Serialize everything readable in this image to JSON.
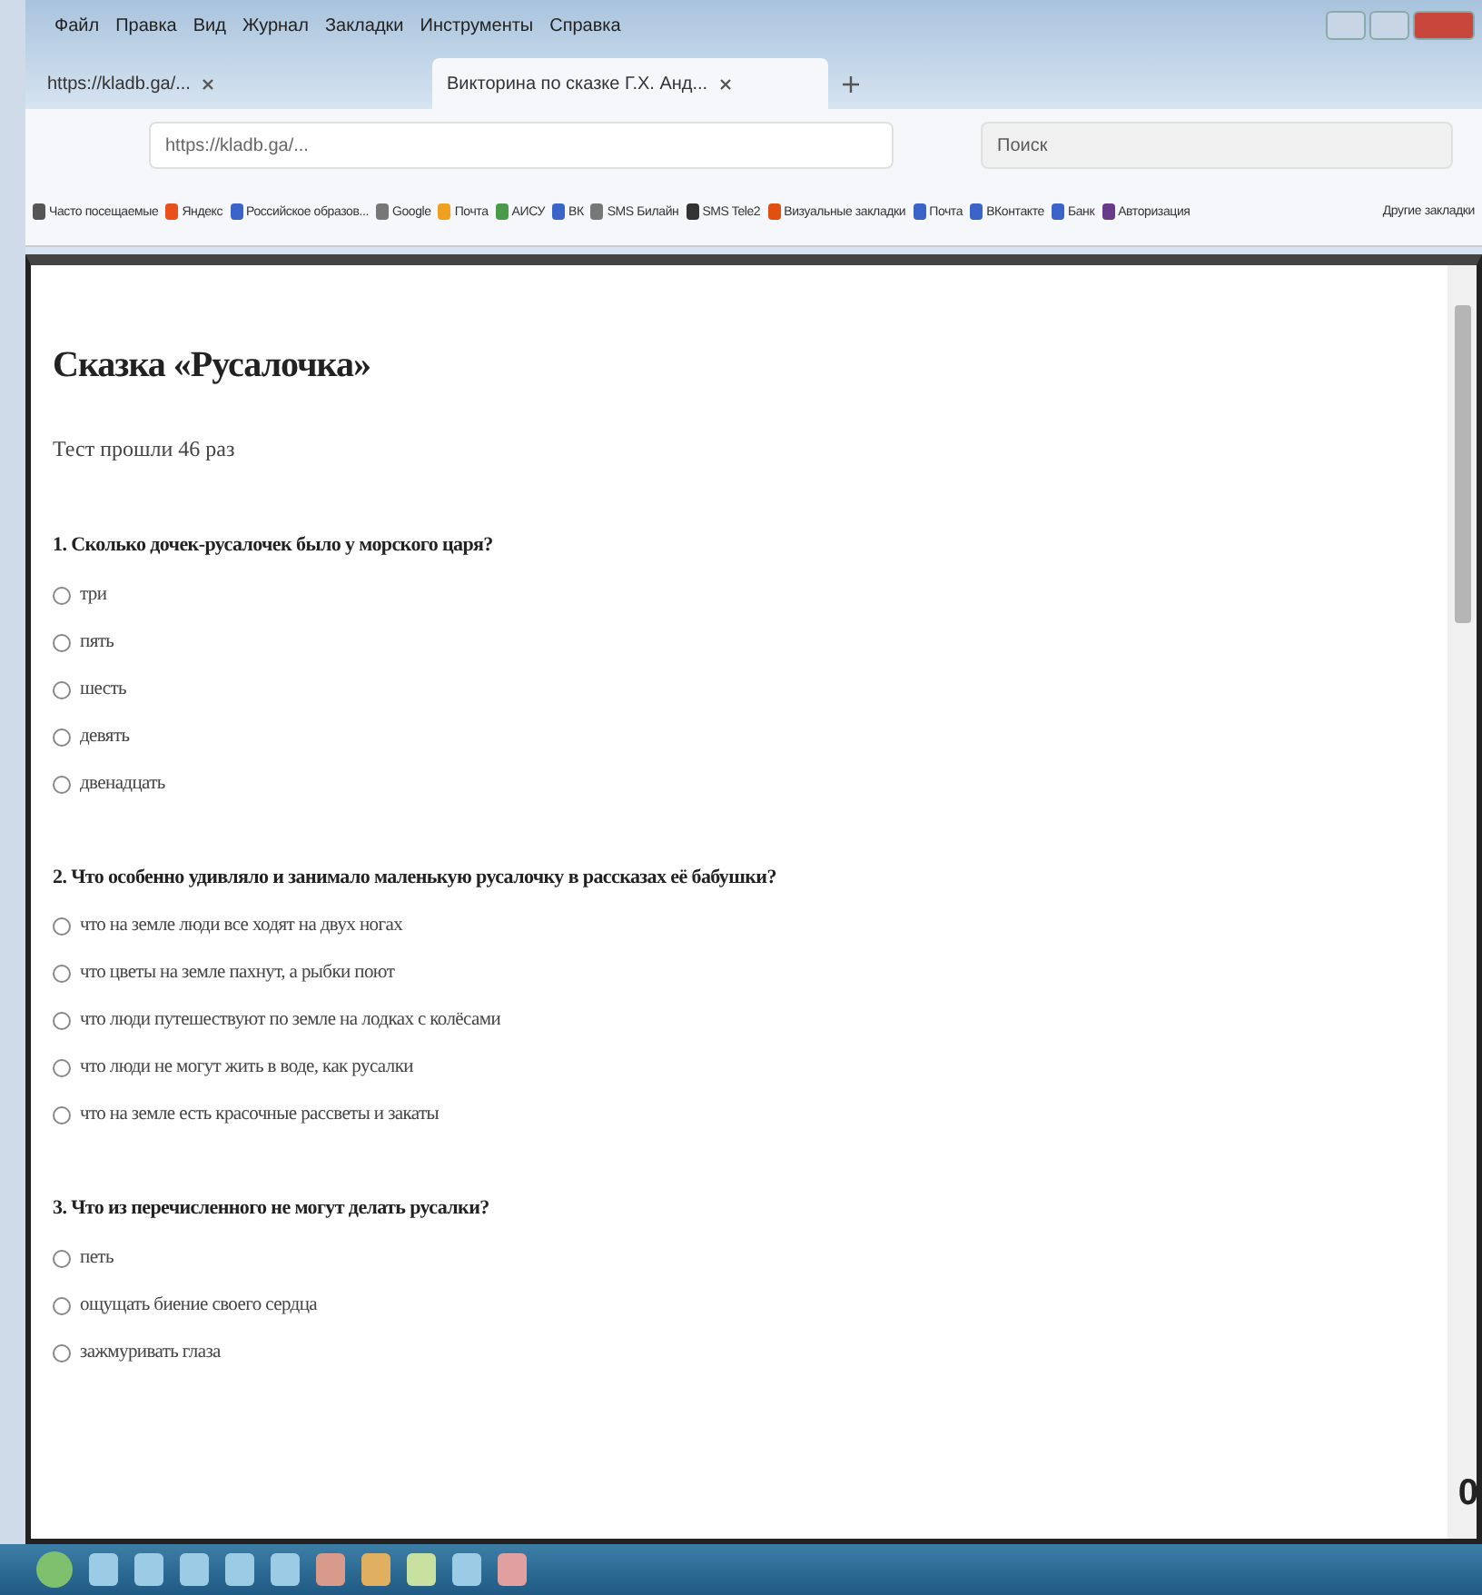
{
  "menu": [
    "Файл",
    "Правка",
    "Вид",
    "Журнал",
    "Закладки",
    "Инструменты",
    "Справка"
  ],
  "tabs": [
    {
      "label": "https://kladb.ga/...",
      "selected": false
    },
    {
      "label": "Викторина по сказке Г.Х. Анд...",
      "selected": true
    }
  ],
  "address": {
    "value": "https://kladb.ga/..."
  },
  "search": {
    "placeholder": "Поиск"
  },
  "bookmarks": [
    {
      "label": "Часто посещаемые",
      "color": "#555555"
    },
    {
      "label": "Яндекс",
      "color": "#e8501c"
    },
    {
      "label": "Российское образов...",
      "color": "#3a64c8"
    },
    {
      "label": "Google",
      "color": "#777777"
    },
    {
      "label": "Почта",
      "color": "#f0a020"
    },
    {
      "label": "АИСУ",
      "color": "#4a9a4a"
    },
    {
      "label": "ВК",
      "color": "#3a64c8"
    },
    {
      "label": "SMS Билайн",
      "color": "#777777"
    },
    {
      "label": "SMS Tele2",
      "color": "#333333"
    },
    {
      "label": "Визуальные закладки",
      "color": "#e05010"
    },
    {
      "label": "Почта",
      "color": "#3a64c8"
    },
    {
      "label": "ВКонтакте",
      "color": "#3a64c8"
    },
    {
      "label": "Банк",
      "color": "#3a64c8"
    },
    {
      "label": "Авторизация",
      "color": "#6a3a8a"
    }
  ],
  "other_bookmarks": "Другие закладки",
  "page": {
    "title": "Сказка «Русалочка»",
    "passed": "Тест прошли 46 раз",
    "questions": [
      {
        "text": "1. Сколько дочек-русалочек было у морского царя?",
        "options": [
          {
            "label": "три",
            "selected": false
          },
          {
            "label": "пять",
            "selected": false
          },
          {
            "label": "шесть",
            "selected": false
          },
          {
            "label": "девять",
            "selected": false
          },
          {
            "label": "двенадцать",
            "selected": false
          }
        ]
      },
      {
        "text": "2. Что особенно удивляло и занимало маленькую русалочку в рассказах её бабушки?",
        "options": [
          {
            "label": "что на земле люди все ходят на двух ногах",
            "selected": false
          },
          {
            "label": "что цветы на земле пахнут, а рыбки поют",
            "selected": false
          },
          {
            "label": "что люди путешествуют по земле на лодках с колёсами",
            "selected": false
          },
          {
            "label": "что люди не могут жить в воде, как русалки",
            "selected": false
          },
          {
            "label": "что на земле есть красочные рассветы и закаты",
            "selected": false
          }
        ]
      },
      {
        "text": "3. Что из перечисленного не могут делать русалки?",
        "options": [
          {
            "label": "петь",
            "selected": false
          },
          {
            "label": "ощущать биение своего сердца",
            "selected": false
          },
          {
            "label": "зажмуривать глаза",
            "selected": false
          }
        ]
      }
    ],
    "score": "0"
  }
}
